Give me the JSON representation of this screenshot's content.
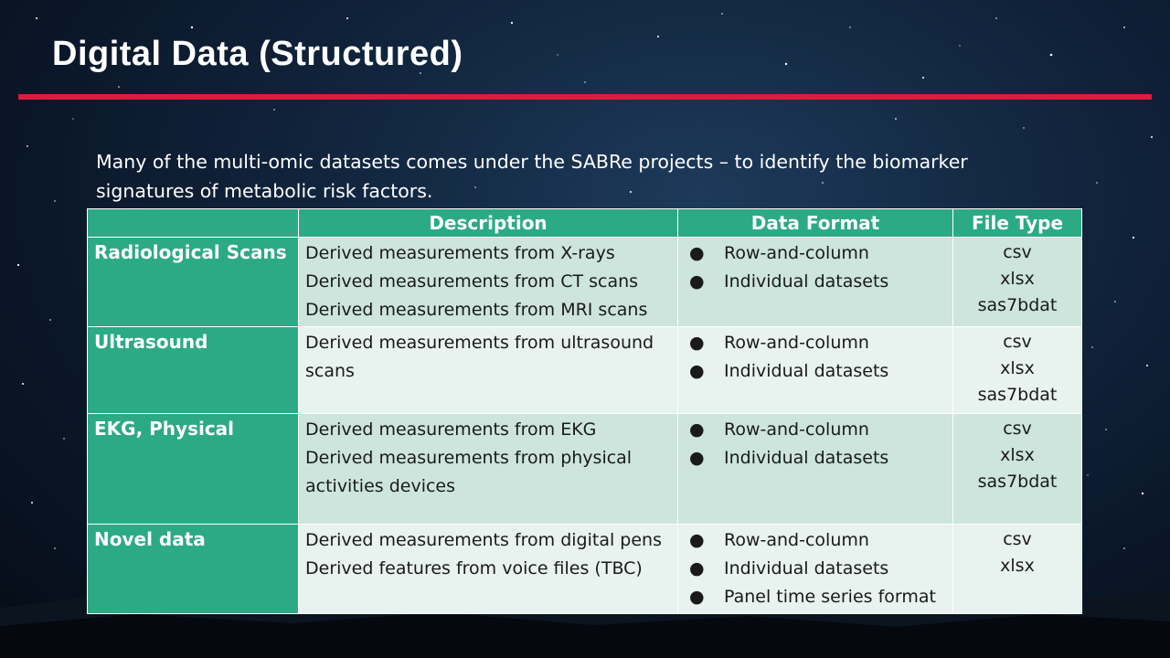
{
  "title": "Digital Data (Structured)",
  "intro": "Many of the multi-omic datasets comes under the SABRe projects – to identify the biomarker signatures of metabolic risk factors.",
  "colors": {
    "accent_rule": "#d81e3b",
    "table_header": "#2baa85",
    "row_dark": "#cde5dc",
    "row_light": "#e8f2ee"
  },
  "table": {
    "headers": [
      "",
      "Description",
      "Data Format",
      "File Type"
    ],
    "rows": [
      {
        "category": "Radiological Scans",
        "description": [
          "Derived measurements from X-rays",
          "Derived measurements from CT scans",
          "Derived measurements from MRI scans"
        ],
        "formats": [
          "Row-and-column",
          "Individual datasets"
        ],
        "file_types": [
          "csv",
          "xlsx",
          "sas7bdat"
        ]
      },
      {
        "category": "Ultrasound",
        "description": [
          "Derived measurements from ultrasound scans"
        ],
        "formats": [
          "Row-and-column",
          "Individual datasets"
        ],
        "file_types": [
          "csv",
          "xlsx",
          "sas7bdat"
        ]
      },
      {
        "category": "EKG, Physical",
        "description": [
          "Derived measurements from EKG",
          "Derived measurements from physical activities devices"
        ],
        "formats": [
          "Row-and-column",
          "Individual datasets"
        ],
        "file_types": [
          "csv",
          "xlsx",
          "sas7bdat"
        ]
      },
      {
        "category": "Novel data",
        "description": [
          "Derived measurements from digital pens",
          "Derived features from voice files (TBC)"
        ],
        "formats": [
          "Row-and-column",
          "Individual datasets",
          "Panel time series format"
        ],
        "file_types": [
          "csv",
          "xlsx"
        ]
      }
    ]
  }
}
